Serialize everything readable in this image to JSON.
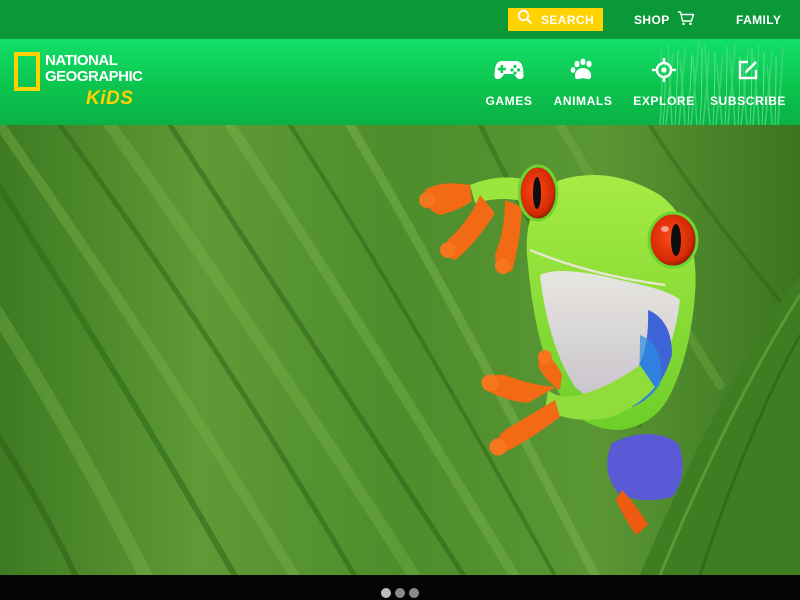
{
  "utility": {
    "search_label": "SEARCH",
    "shop_label": "SHOP",
    "family_label": "FAMILY"
  },
  "logo": {
    "line1": "NATIONAL",
    "line2": "GEOGRAPHIC",
    "line3": "KiDS"
  },
  "nav": {
    "items": [
      {
        "label": "GAMES",
        "icon": "gamepad-icon"
      },
      {
        "label": "ANIMALS",
        "icon": "paw-icon"
      },
      {
        "label": "EXPLORE",
        "icon": "crosshair-icon"
      },
      {
        "label": "SUBSCRIBE",
        "icon": "edit-icon"
      }
    ]
  },
  "hero": {
    "subject": "red-eyed tree frog on leaf"
  },
  "carousel": {
    "slide_count": 3,
    "active_index": 0
  },
  "colors": {
    "utility_bar": "#0a9838",
    "nav_top": "#12e06a",
    "nav_bottom": "#09b245",
    "accent_yellow": "#ffd200",
    "text_white": "#ffffff"
  }
}
